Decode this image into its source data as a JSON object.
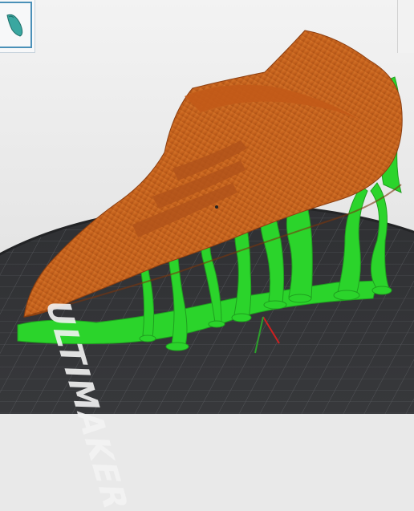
{
  "app": {
    "object_list": {
      "selected_icon": "shoe-model-icon"
    },
    "build_plate": {
      "logo_text": "ULTIMAKER"
    },
    "scene": {
      "model_name": "",
      "model_color": "#c8641e",
      "support_color": "#2bd42b",
      "plate_color": "#333436",
      "grid_color": "#5a5c60"
    }
  }
}
